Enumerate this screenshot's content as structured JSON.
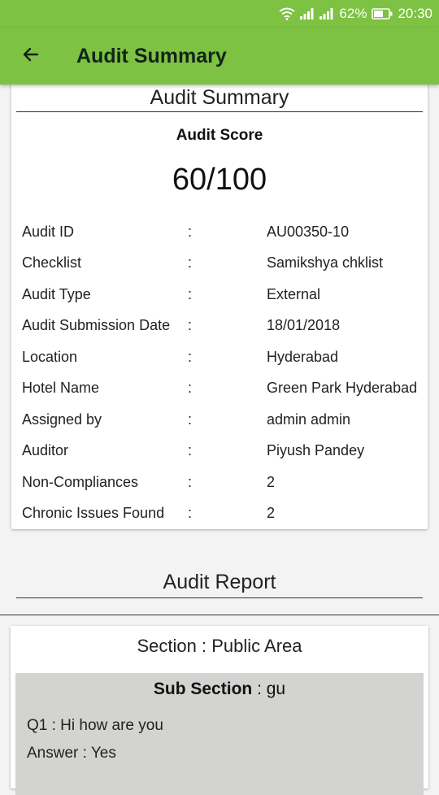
{
  "status_bar": {
    "battery": "62%",
    "time": "20:30"
  },
  "app_bar": {
    "title": "Audit Summary"
  },
  "summary": {
    "title": "Audit Summary",
    "score_label": "Audit Score",
    "score_value": "60/100",
    "colon": ":",
    "rows": [
      {
        "label": "Audit ID",
        "value": "AU00350-10"
      },
      {
        "label": "Checklist",
        "value": "Samikshya chklist"
      },
      {
        "label": "Audit Type",
        "value": "External"
      },
      {
        "label": "Audit Submission Date",
        "value": "18/01/2018"
      },
      {
        "label": "Location",
        "value": "Hyderabad"
      },
      {
        "label": "Hotel Name",
        "value": "Green Park Hyderabad"
      },
      {
        "label": "Assigned by",
        "value": "admin admin"
      },
      {
        "label": "Auditor",
        "value": "Piyush Pandey"
      },
      {
        "label": "Non-Compliances",
        "value": "2"
      },
      {
        "label": "Chronic Issues Found",
        "value": "2"
      }
    ]
  },
  "report": {
    "title": "Audit Report",
    "section_title": "Section : Public Area",
    "subsection_label": "Sub Section",
    "subsection_value": " : gu",
    "question": "Q1 : Hi how are you",
    "answer": "Answer : Yes"
  }
}
